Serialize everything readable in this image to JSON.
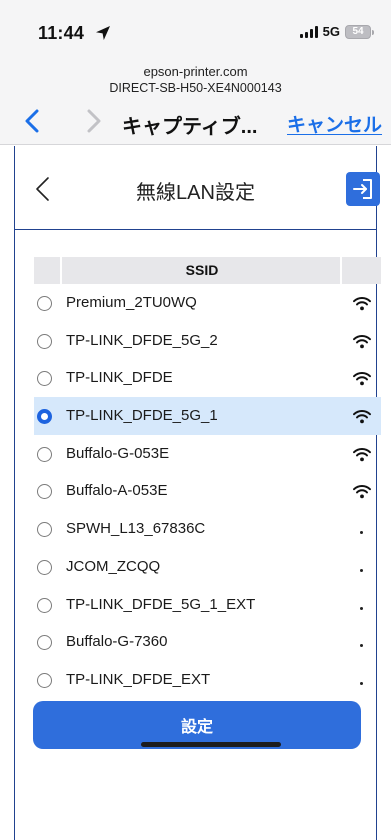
{
  "status_bar": {
    "time": "11:44",
    "network_type": "5G",
    "battery": "54"
  },
  "portal": {
    "domain": "epson-printer.com",
    "network": "DIRECT-SB-H50-XE4N000143",
    "title": "キャプティブ...",
    "cancel_label": "キャンセル"
  },
  "app": {
    "title": "無線LAN設定",
    "submit_label": "設定"
  },
  "table": {
    "header": "SSID",
    "rows": [
      {
        "ssid": "Premium_2TU0WQ",
        "signal": "wifi",
        "selected": false
      },
      {
        "ssid": "TP-LINK_DFDE_5G_2",
        "signal": "wifi",
        "selected": false
      },
      {
        "ssid": "TP-LINK_DFDE",
        "signal": "wifi",
        "selected": false
      },
      {
        "ssid": "TP-LINK_DFDE_5G_1",
        "signal": "wifi",
        "selected": true
      },
      {
        "ssid": "Buffalo-G-053E",
        "signal": "wifi",
        "selected": false
      },
      {
        "ssid": "Buffalo-A-053E",
        "signal": "wifi",
        "selected": false
      },
      {
        "ssid": "SPWH_L13_67836C",
        "signal": "weak",
        "selected": false
      },
      {
        "ssid": "JCOM_ZCQQ",
        "signal": "weak",
        "selected": false
      },
      {
        "ssid": "TP-LINK_DFDE_5G_1_EXT",
        "signal": "weak",
        "selected": false
      },
      {
        "ssid": "Buffalo-G-7360",
        "signal": "weak",
        "selected": false
      },
      {
        "ssid": "TP-LINK_DFDE_EXT",
        "signal": "weak",
        "selected": false
      }
    ]
  },
  "colors": {
    "accent": "#2f6edc",
    "link": "#1b6fe8",
    "selected_row": "#d6e8fb",
    "frame_border": "#21428f"
  },
  "icons": {
    "location": "location-arrow-icon",
    "back": "chevron-left-icon",
    "forward": "chevron-right-icon",
    "exit": "exit-icon",
    "wifi": "wifi-icon"
  }
}
